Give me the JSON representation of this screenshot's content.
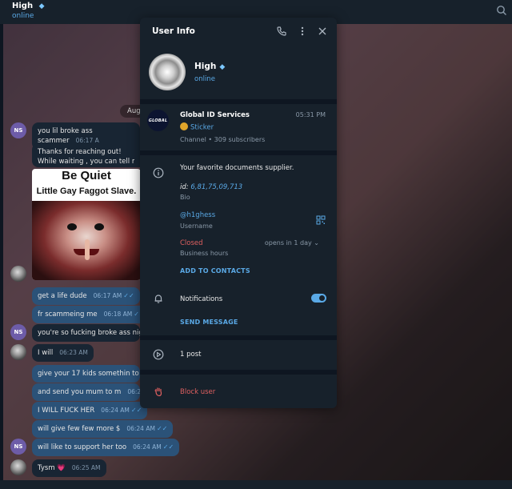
{
  "header": {
    "title": "High",
    "status": "online"
  },
  "chat": {
    "date_pill": "Augu",
    "messages": [
      {
        "text": "you lil broke ass scammer",
        "time": "06:17 A"
      },
      {
        "line1": "Thanks for reaching out!",
        "line2": "While waiting , you can tell me abo"
      },
      {
        "meme_line1": "Be Quiet",
        "meme_line2": "Little Gay Faggot Slave."
      },
      {
        "text": "get a life dude",
        "time": "06:17 AM"
      },
      {
        "text": "fr scammeing me",
        "time": "06:18 AM"
      },
      {
        "text": "you're so fucking broke ass nigga",
        "time": ""
      },
      {
        "text": "I will",
        "time": "06:23 AM"
      },
      {
        "text": "give your 17 kids somethin to eat",
        "time": ""
      },
      {
        "text": "and send you mum to m",
        "time": "06:24 AM"
      },
      {
        "text": "I WILL FUCK HER",
        "time": "06:24 AM"
      },
      {
        "text": "will give few few more $",
        "time": "06:24 AM"
      },
      {
        "text": "will like to support her too",
        "time": "06:24 AM"
      },
      {
        "text": "Tysm 💗",
        "time": "06:25 AM"
      }
    ],
    "avatar_initials": "NS"
  },
  "panel": {
    "title": "User Info",
    "profile": {
      "name": "High",
      "status": "online"
    },
    "channel": {
      "avatar_text": "GLOBAL",
      "name": "Global ID Services",
      "time": "05:31 PM",
      "sticker": "Sticker",
      "meta": "Channel • 309 subscribers"
    },
    "bio": {
      "text": "Your favorite documents supplier.",
      "id_label": "id: ",
      "id_value": "6,81,75,09,713",
      "label": "Bio"
    },
    "username": {
      "value": "@h1ghess",
      "label": "Username"
    },
    "business": {
      "status": "Closed",
      "opens": "opens in 1 day",
      "label": "Business hours"
    },
    "add_contacts": "ADD TO CONTACTS",
    "notifications": {
      "label": "Notifications",
      "enabled": true
    },
    "send_message": "SEND MESSAGE",
    "posts": "1 post",
    "block": "Block user"
  },
  "colors": {
    "accent": "#5aa9e6",
    "danger": "#e06060",
    "panel": "#17212b",
    "bg": "#0e1621"
  },
  "icons": [
    "phone-icon",
    "more-vertical-icon",
    "close-icon",
    "info-icon",
    "qr-code-icon",
    "bell-icon",
    "posts-icon",
    "block-hand-icon",
    "search-icon",
    "chevron-down-icon"
  ]
}
